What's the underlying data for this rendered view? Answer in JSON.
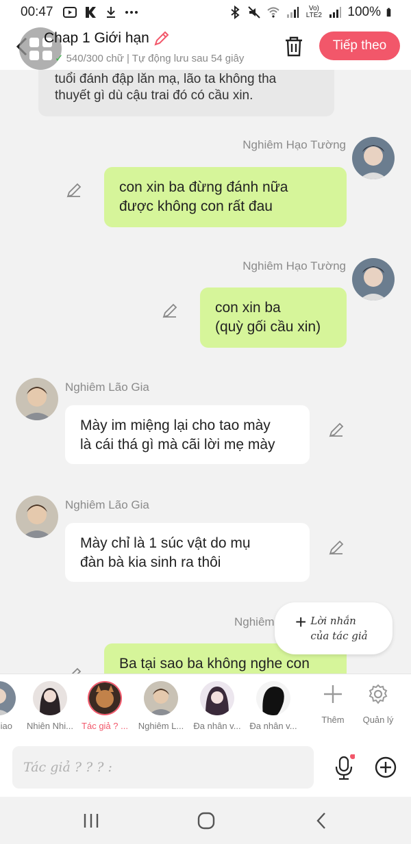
{
  "status_bar": {
    "time": "00:47",
    "left_icons": [
      "youtube-icon",
      "k-icon",
      "download-icon",
      "more-icon"
    ],
    "battery": "100%",
    "network": "Vo) LTE2"
  },
  "header": {
    "title": "Chap 1 Giới hạn",
    "subtitle": "540/300 chữ | Tự động lưu sau 54 giây",
    "next_label": "Tiếp theo"
  },
  "messages": [
    {
      "type": "narration",
      "lines": [
        "tuổi đánh đập lăn mạ, lão ta không tha",
        "thuyết gì dù cậu trai đó có cầu xin."
      ]
    },
    {
      "type": "right",
      "sender": "Nghiêm Hạo Tường",
      "lines": [
        "con xin ba đừng đánh nữa",
        "được không con rất đau"
      ]
    },
    {
      "type": "right",
      "sender": "Nghiêm Hạo Tường",
      "lines": [
        "con xin ba",
        "(quỳ gối cầu xin)"
      ]
    },
    {
      "type": "left",
      "sender": "Nghiêm Lão Gia",
      "lines": [
        "Mày im miệng lại cho tao mày",
        "là cái thá gì mà cãi lời mẹ mày"
      ]
    },
    {
      "type": "left",
      "sender": "Nghiêm Lão Gia",
      "lines": [
        "Mày chỉ là 1 súc vật do mụ",
        "đàn bà kia sinh ra thôi"
      ]
    },
    {
      "type": "right",
      "sender": "Nghiêm",
      "lines": [
        "Ba tại sao ba không nghe con"
      ]
    }
  ],
  "note_popup": {
    "line1": "Lời nhắn",
    "line2": "của tác giả"
  },
  "characters": [
    {
      "name": "Siao"
    },
    {
      "name": "Nhiên Nhi..."
    },
    {
      "name": "Tác giả ? ..."
    },
    {
      "name": "Nghiêm L..."
    },
    {
      "name": "Đa nhân v..."
    },
    {
      "name": "Đa nhân v..."
    }
  ],
  "tools": {
    "add_label": "Thêm",
    "manage_label": "Quản lý"
  },
  "input": {
    "placeholder": "Tác giả ? ? ? :"
  },
  "colors": {
    "accent": "#f2576a",
    "green_bubble": "#d6f59a",
    "white_bubble": "#ffffff",
    "narration_bubble": "#e8e8e8"
  }
}
